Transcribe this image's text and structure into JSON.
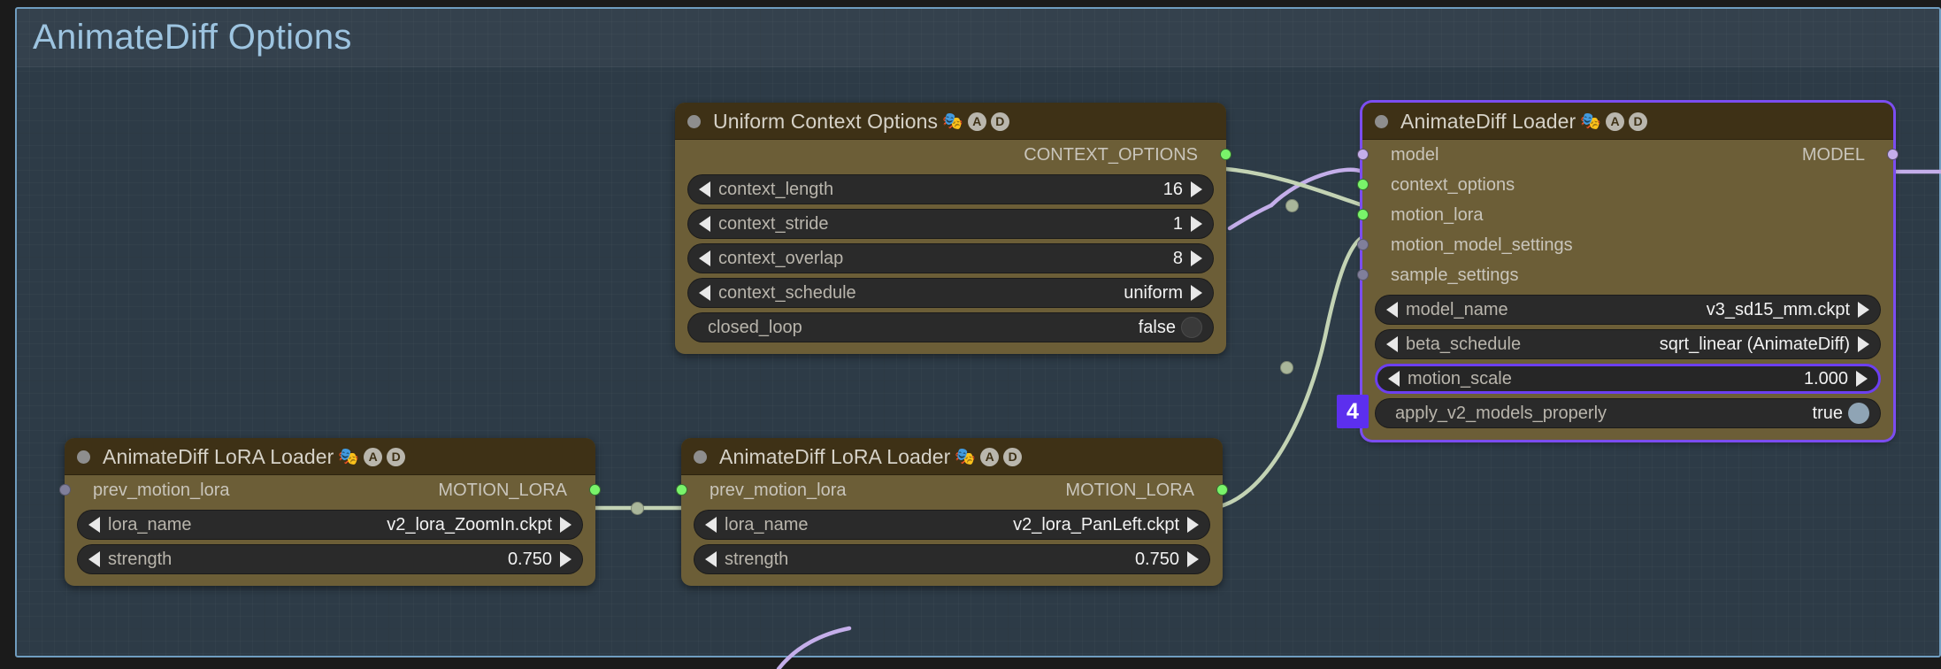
{
  "group": {
    "title": "AnimateDiff Options",
    "border_color": "#6f9dc0",
    "fill_color": "#2d3b47"
  },
  "theme": {
    "canvas_bg": "#1b1b1b",
    "node_body": "#6c5e37",
    "node_header": "#3e3116",
    "widget_bg": "#2a2a2a",
    "accent_selection": "#6c3ff0",
    "link_green": "#c3d3b4",
    "link_purple": "#c4aeea",
    "slot_green": "#79f36a",
    "slot_purple": "#c4aeea",
    "slot_muted": "#807f9b"
  },
  "marker": {
    "label": "4",
    "color": "#5c2fee"
  },
  "nodes": [
    {
      "id": "uniform-context-options",
      "title": "Uniform Context Options",
      "badges": [
        "🎭",
        "A",
        "D"
      ],
      "selected": false,
      "inputs": [],
      "outputs": [
        {
          "label": "CONTEXT_OPTIONS",
          "dot": "green"
        }
      ],
      "widgets": [
        {
          "name": "context_length",
          "value": "16",
          "type": "combo"
        },
        {
          "name": "context_stride",
          "value": "1",
          "type": "combo"
        },
        {
          "name": "context_overlap",
          "value": "8",
          "type": "combo"
        },
        {
          "name": "context_schedule",
          "value": "uniform",
          "type": "combo"
        },
        {
          "name": "closed_loop",
          "value": "false",
          "type": "toggle",
          "state": "off"
        }
      ]
    },
    {
      "id": "animatediff-loader",
      "title": "AnimateDiff Loader",
      "badges": [
        "🎭",
        "A",
        "D"
      ],
      "selected": true,
      "inputs": [
        {
          "label": "model",
          "dot": "purple"
        },
        {
          "label": "context_options",
          "dot": "green"
        },
        {
          "label": "motion_lora",
          "dot": "green"
        },
        {
          "label": "motion_model_settings",
          "dot": "muted"
        },
        {
          "label": "sample_settings",
          "dot": "muted"
        }
      ],
      "outputs": [
        {
          "label": "MODEL",
          "dot": "purple"
        }
      ],
      "widgets": [
        {
          "name": "model_name",
          "value": "v3_sd15_mm.ckpt",
          "type": "combo"
        },
        {
          "name": "beta_schedule",
          "value": "sqrt_linear (AnimateDiff)",
          "type": "combo"
        },
        {
          "name": "motion_scale",
          "value": "1.000",
          "type": "combo",
          "highlight": true
        },
        {
          "name": "apply_v2_models_properly",
          "value": "true",
          "type": "toggle",
          "state": "on"
        }
      ]
    },
    {
      "id": "animatediff-lora-loader-1",
      "title": "AnimateDiff LoRA Loader",
      "badges": [
        "🎭",
        "A",
        "D"
      ],
      "selected": false,
      "inputs": [
        {
          "label": "prev_motion_lora",
          "dot": "muted"
        }
      ],
      "outputs": [
        {
          "label": "MOTION_LORA",
          "dot": "green"
        }
      ],
      "widgets": [
        {
          "name": "lora_name",
          "value": "v2_lora_ZoomIn.ckpt",
          "type": "combo"
        },
        {
          "name": "strength",
          "value": "0.750",
          "type": "combo"
        }
      ]
    },
    {
      "id": "animatediff-lora-loader-2",
      "title": "AnimateDiff LoRA Loader",
      "badges": [
        "🎭",
        "A",
        "D"
      ],
      "selected": false,
      "inputs": [
        {
          "label": "prev_motion_lora",
          "dot": "green"
        }
      ],
      "outputs": [
        {
          "label": "MOTION_LORA",
          "dot": "green"
        }
      ],
      "widgets": [
        {
          "name": "lora_name",
          "value": "v2_lora_PanLeft.ckpt",
          "type": "combo"
        },
        {
          "name": "strength",
          "value": "0.750",
          "type": "combo"
        }
      ]
    }
  ],
  "links": [
    {
      "from": "uniform-context-options.CONTEXT_OPTIONS",
      "to": "animatediff-loader.context_options",
      "color": "green"
    },
    {
      "from": "animatediff-lora-loader-1.MOTION_LORA",
      "to": "animatediff-lora-loader-2.prev_motion_lora",
      "color": "green"
    },
    {
      "from": "animatediff-lora-loader-2.MOTION_LORA",
      "to": "animatediff-loader.motion_lora",
      "color": "green"
    },
    {
      "from": "offscreen",
      "to": "animatediff-loader.model",
      "color": "purple"
    },
    {
      "from": "animatediff-loader.MODEL",
      "to": "offscreen",
      "color": "purple"
    },
    {
      "from": "offscreen",
      "to": "offscreen",
      "color": "purple"
    }
  ]
}
